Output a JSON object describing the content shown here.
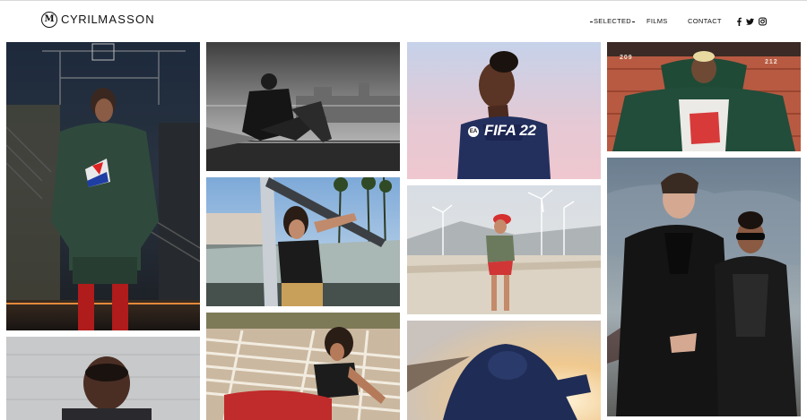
{
  "brand": {
    "first": "CYRIL",
    "last": "MASSON",
    "mark": "M"
  },
  "nav": {
    "selected": "SELECTED",
    "films": "FILMS",
    "contact": "CONTACT"
  },
  "social": [
    "facebook-icon",
    "twitter-icon",
    "instagram-icon"
  ],
  "tiles": {
    "fifa_title": "FIFA 22",
    "fifa_badge": "EA",
    "jersey_left": "209",
    "jersey_right": "212"
  },
  "colors": {
    "text": "#111111",
    "background": "#ffffff",
    "divider": "#d9d9d9"
  }
}
